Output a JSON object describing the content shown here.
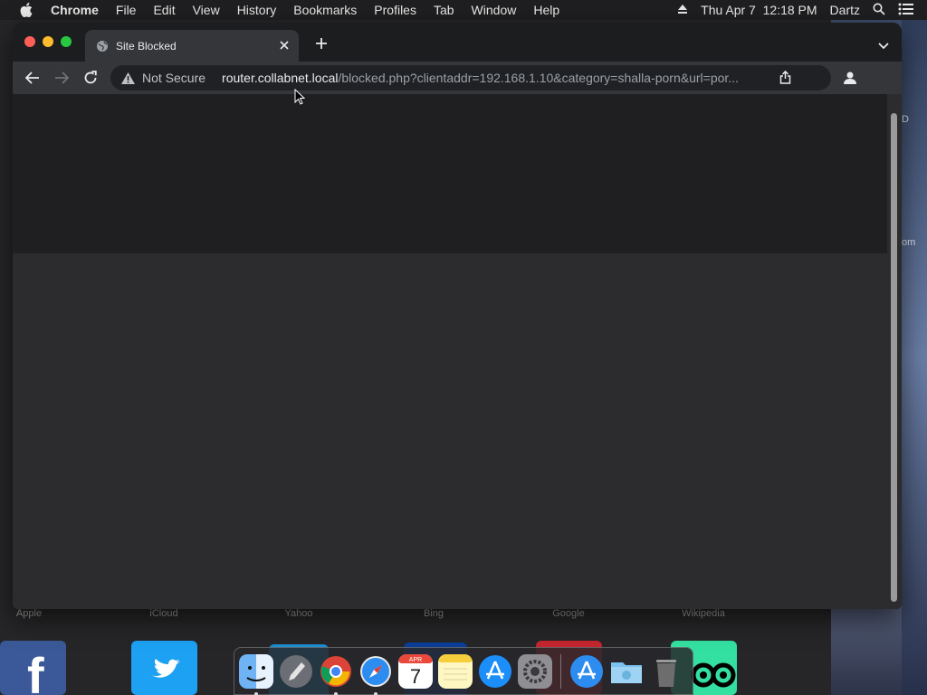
{
  "menubar": {
    "app_name": "Chrome",
    "items": [
      "File",
      "Edit",
      "View",
      "History",
      "Bookmarks",
      "Profiles",
      "Tab",
      "Window",
      "Help"
    ],
    "clock": "Thu Apr 7  12:18 PM",
    "user": "Dartz"
  },
  "background": {
    "labels": [
      "Apple",
      "iCloud",
      "Yahoo",
      "Bing",
      "Google",
      "Wikipedia"
    ],
    "right_fragments": [
      "D",
      "om"
    ]
  },
  "browser": {
    "tab_title": "Site Blocked",
    "security_label": "Not Secure",
    "url_host": "router.collabnet.local",
    "url_path": "/blocked.php?clientaddr=192.168.1.10&category=shalla-porn&url=por..."
  },
  "dock": {
    "apps": [
      "finder",
      "launchpad",
      "chrome",
      "safari",
      "calendar",
      "notes",
      "app-store",
      "system-preferences",
      "app-store-2",
      "downloads",
      "trash"
    ],
    "calendar_day": "7",
    "calendar_month": "APR"
  },
  "colors": {
    "menubar_bg": "#1f1f21",
    "tab_active_bg": "#35363a",
    "omnibox_bg": "#202124",
    "content_bg": "#2c2c2e",
    "traffic_red": "#ff5f57",
    "traffic_yellow": "#febc2e",
    "traffic_green": "#28c840"
  }
}
